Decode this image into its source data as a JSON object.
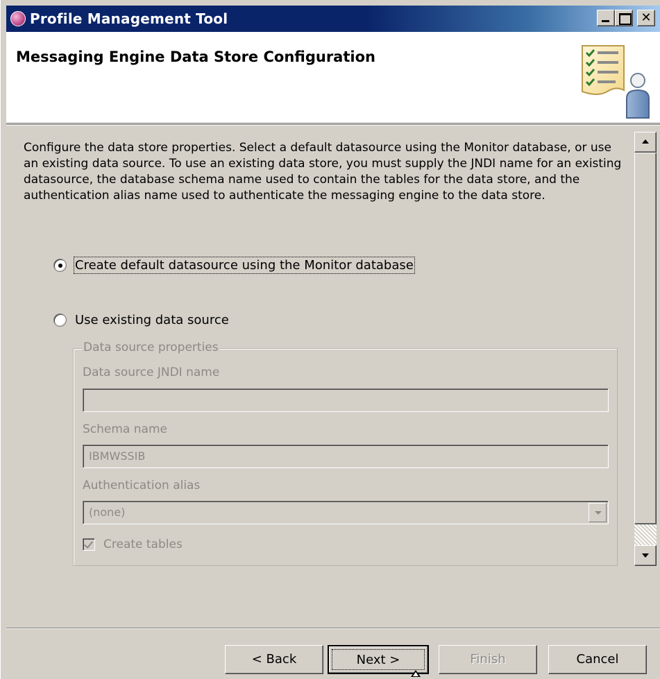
{
  "window": {
    "title": "Profile Management Tool",
    "close_glyph": "✕"
  },
  "banner": {
    "title": "Messaging Engine Data Store Configuration",
    "icon": "checklist-person-icon"
  },
  "description": "Configure the data store properties. Select a default datasource using the Monitor database, or use an existing data source. To use an existing data store, you must supply the JNDI name for an existing datasource, the database schema name used to contain the tables for the data store, and the authentication alias name used to authenticate the messaging engine to the data store.",
  "options": {
    "default_label": "Create default datasource using the Monitor database",
    "default_selected": true,
    "existing_label": "Use existing data source",
    "existing_selected": false
  },
  "data_source_properties": {
    "legend": "Data source properties",
    "jndi_label": "Data source JNDI name",
    "jndi_value": "",
    "schema_label": "Schema name",
    "schema_value": "IBMWSSIB",
    "auth_label": "Authentication alias",
    "auth_value": "(none)",
    "create_tables_label": "Create tables",
    "create_tables_checked": true,
    "enabled": false
  },
  "buttons": {
    "back": "< Back",
    "next": "Next >",
    "finish": "Finish",
    "cancel": "Cancel",
    "finish_enabled": false
  },
  "colors": {
    "title_bar": "#0a246a",
    "dialog_face": "#d4d0c8",
    "disabled_text": "#8c8a85"
  }
}
